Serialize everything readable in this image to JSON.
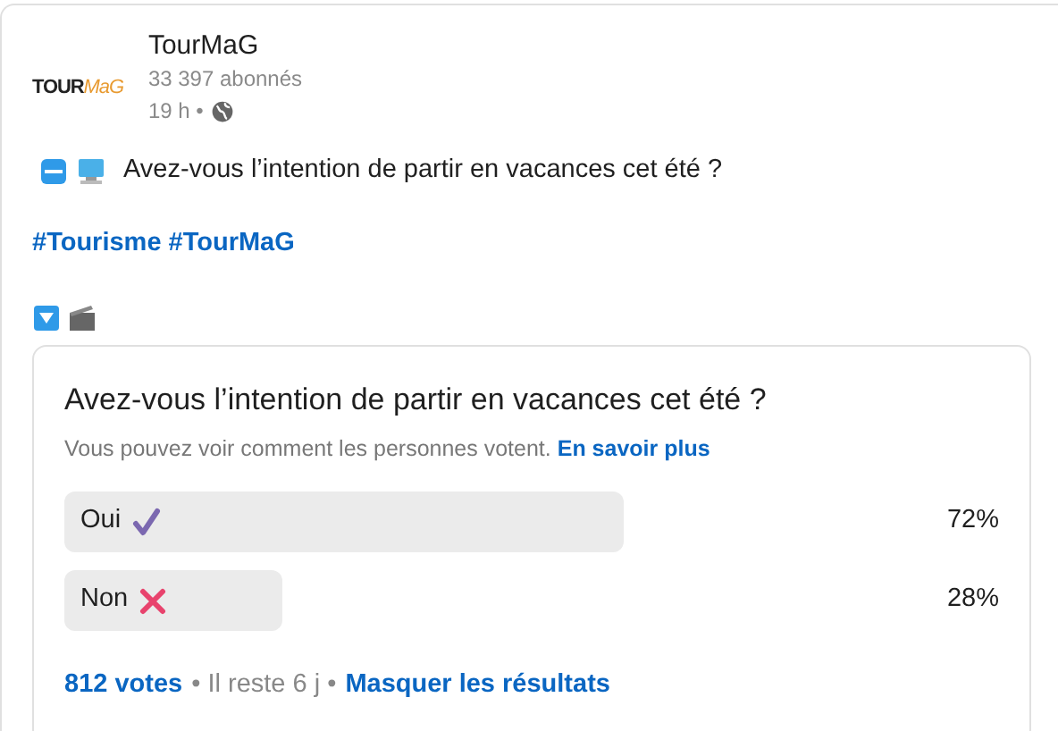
{
  "author": {
    "logo_text": "TOUR",
    "logo_accent": "MaG",
    "name": "TourMaG",
    "followers": "33 397 abonnés",
    "time": "19 h •"
  },
  "post": {
    "text": "Avez-vous l’intention de partir en vacances cet été ?",
    "hashtags": "#Tourisme #TourMaG"
  },
  "poll": {
    "question": "Avez-vous l’intention de partir en vacances cet été ?",
    "note": "Vous pouvez voir comment les personnes votent.",
    "note_link": "En savoir plus",
    "options": [
      {
        "label": "Oui",
        "kind": "check",
        "percent": "72%"
      },
      {
        "label": "Non",
        "kind": "cross",
        "percent": "28%"
      }
    ],
    "votes": "812 votes",
    "remaining": "• Il reste 6 j •",
    "hide_results": "Masquer les résultats"
  }
}
